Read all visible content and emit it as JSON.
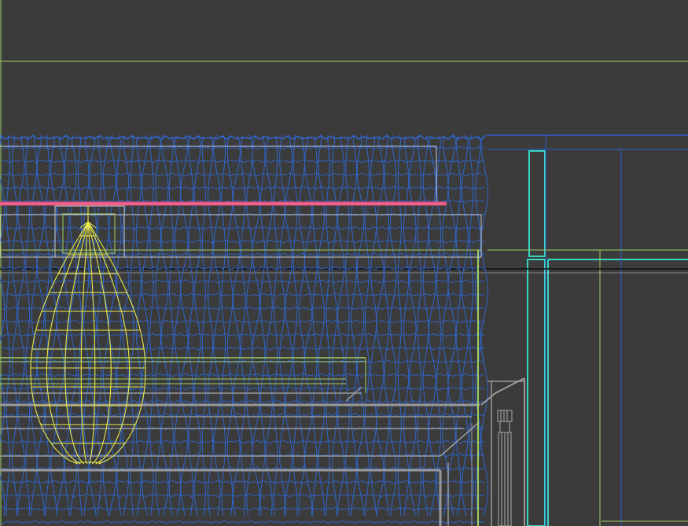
{
  "viewport": {
    "background": "#3b3b3b",
    "render_mode": "wireframe"
  },
  "colors": {
    "curtain_mesh": "#2f68d6",
    "curtain_rod": "#e0507a",
    "lamp_wire": "#e8e84a",
    "light_guide": "#9fd060",
    "cyan_frame": "#39d6c4",
    "cabinet_gray": "#9a9a9a",
    "wall_blue": "#2e5ccf",
    "black_edge": "#111111"
  },
  "objects": [
    {
      "name": "curtain",
      "kind": "wireframe-mesh"
    },
    {
      "name": "curtain-rod",
      "kind": "cylinder"
    },
    {
      "name": "pendant-lamp",
      "kind": "wireframe-mesh"
    },
    {
      "name": "window-frame",
      "kind": "box"
    },
    {
      "name": "cabinet",
      "kind": "box"
    }
  ]
}
